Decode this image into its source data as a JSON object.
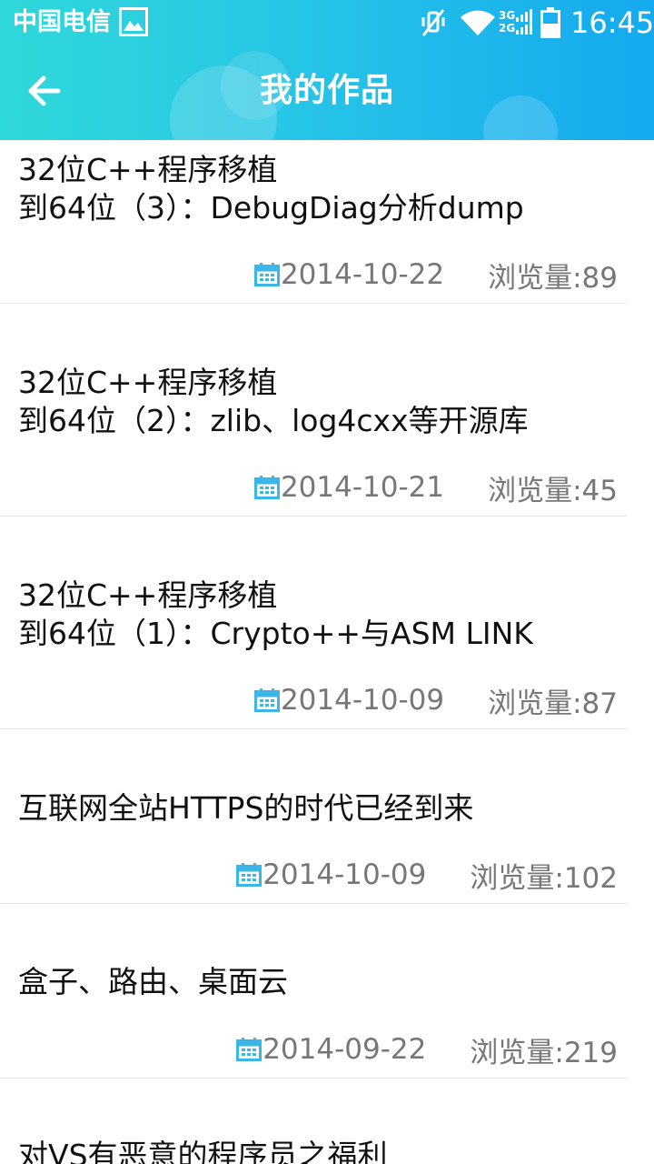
{
  "status_bar": {
    "carrier": "中国电信",
    "network_3g": "3G",
    "network_2g": "2G",
    "time": "16:45"
  },
  "header": {
    "title": "我的作品"
  },
  "colors": {
    "header_gradient_start": "#2fd8d8",
    "header_gradient_end": "#15a9ef",
    "calendar_icon": "#3ab6e8"
  },
  "icons": {
    "back": "back-arrow-icon",
    "calendar": "calendar-icon"
  },
  "list": {
    "items": [
      {
        "title": "32位C++程序移植\n到64位（3）：DebugDiag分析dump",
        "date": "2014-10-22",
        "views": "浏览量:89"
      },
      {
        "title": "32位C++程序移植\n到64位（2）：zlib、log4cxx等开源库",
        "date": "2014-10-21",
        "views": "浏览量:45"
      },
      {
        "title": "32位C++程序移植\n到64位（1）：Crypto++与ASM LINK",
        "date": "2014-10-09",
        "views": "浏览量:87"
      },
      {
        "title": "互联网全站HTTPS的时代已经到来",
        "date": "2014-10-09",
        "views": "浏览量:102"
      },
      {
        "title": "盒子、路由、桌面云",
        "date": "2014-09-22",
        "views": "浏览量:219"
      },
      {
        "title": "对VS有恶意的程序员之福利",
        "date": "",
        "views": ""
      }
    ]
  }
}
